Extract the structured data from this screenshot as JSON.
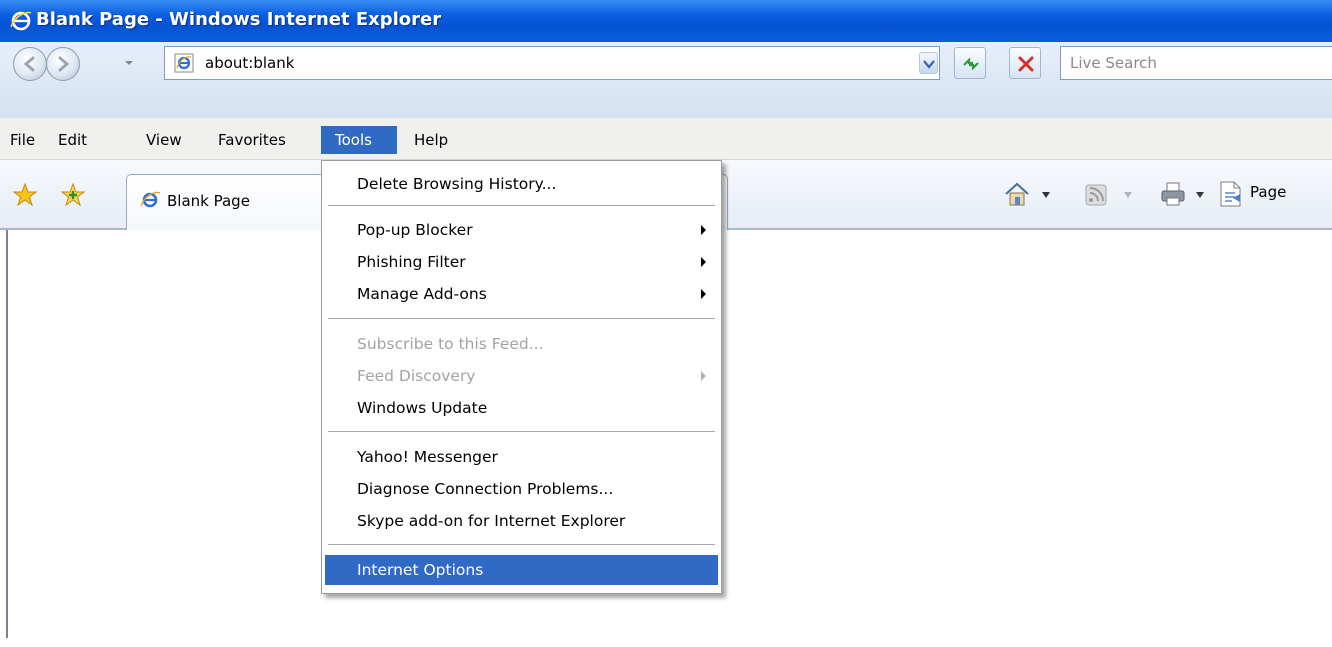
{
  "window": {
    "title": "Blank Page - Windows Internet Explorer"
  },
  "address_bar": {
    "url": "about:blank",
    "search_placeholder": "Live Search"
  },
  "menu": {
    "items": [
      "File",
      "Edit",
      "View",
      "Favorites",
      "Tools",
      "Help"
    ],
    "active": "Tools"
  },
  "tab": {
    "label": "Blank Page"
  },
  "command_bar": {
    "page_label": "Page"
  },
  "tools_menu": {
    "groups": [
      [
        {
          "label": "Delete Browsing History...",
          "enabled": true,
          "submenu": false
        }
      ],
      [
        {
          "label": "Pop-up Blocker",
          "enabled": true,
          "submenu": true
        },
        {
          "label": "Phishing Filter",
          "enabled": true,
          "submenu": true
        },
        {
          "label": "Manage Add-ons",
          "enabled": true,
          "submenu": true
        }
      ],
      [
        {
          "label": "Subscribe to this Feed...",
          "enabled": false,
          "submenu": false
        },
        {
          "label": "Feed Discovery",
          "enabled": false,
          "submenu": true
        },
        {
          "label": "Windows Update",
          "enabled": true,
          "submenu": false
        }
      ],
      [
        {
          "label": "Yahoo! Messenger",
          "enabled": true,
          "submenu": false
        },
        {
          "label": "Diagnose Connection Problems...",
          "enabled": true,
          "submenu": false
        },
        {
          "label": "Skype add-on for Internet Explorer",
          "enabled": true,
          "submenu": false
        }
      ],
      [
        {
          "label": "Internet Options",
          "enabled": true,
          "submenu": false,
          "highlighted": true
        }
      ]
    ]
  },
  "icons": {
    "title": "ie-logo-icon",
    "back": "back-arrow-icon",
    "forward": "forward-arrow-icon",
    "refresh": "refresh-icon",
    "stop": "stop-icon",
    "favorites": "favorites-star-icon",
    "add_favorites": "add-favorites-icon",
    "home": "home-icon",
    "feeds": "feeds-icon",
    "print": "print-icon",
    "page": "page-icon"
  },
  "colors": {
    "titlebar": "#0a5fe0",
    "menu_highlight": "#316ac5",
    "disabled_text": "#a3a3a3"
  }
}
